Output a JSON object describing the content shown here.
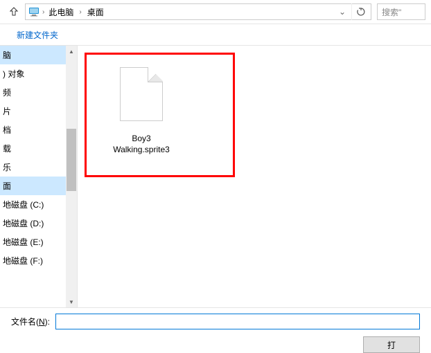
{
  "nav": {
    "crumb1": "此电脑",
    "crumb2": "桌面"
  },
  "search": {
    "placeholder": "搜索\""
  },
  "toolbar": {
    "new_folder": "新建文件夹"
  },
  "sidebar": {
    "items": [
      "脑",
      ") 对象",
      "频",
      "片",
      "档",
      "载",
      "乐",
      "面",
      "地磁盘 (C:)",
      "地磁盘 (D:)",
      "地磁盘 (E:)",
      "地磁盘 (F:)"
    ]
  },
  "files": {
    "item0": {
      "name": "Boy3 Walking.sprite3"
    }
  },
  "footer": {
    "filename_label_pre": "文件名(",
    "filename_label_u": "N",
    "filename_label_post": "):",
    "filename_value": "",
    "open_btn": "打"
  }
}
